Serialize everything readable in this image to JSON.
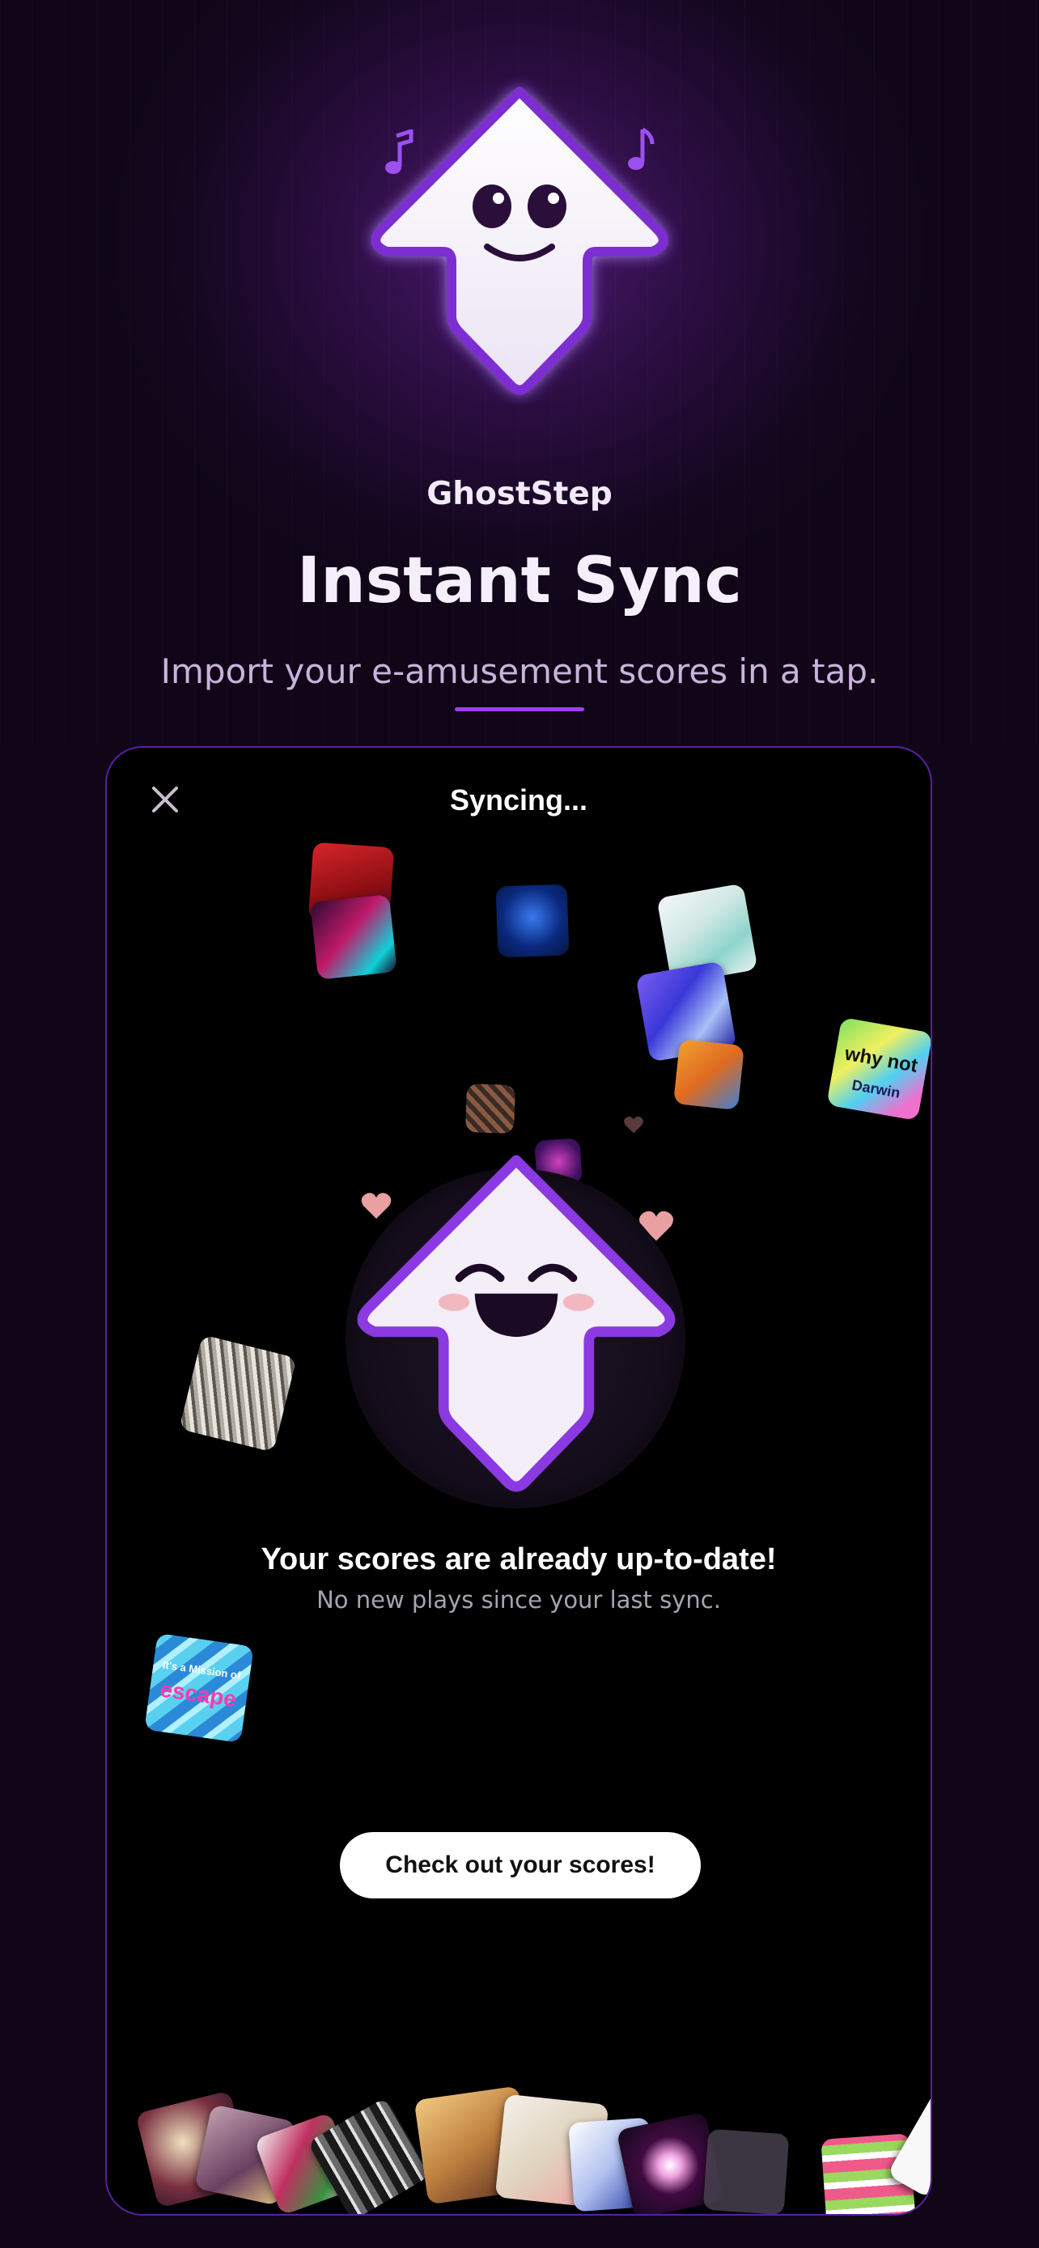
{
  "app_name": "GhostStep",
  "hero": {
    "headline": "Instant Sync",
    "subline": "Import your e-amusement scores in a tap."
  },
  "modal": {
    "title": "Syncing...",
    "result_title": "Your scores are already up-to-date!",
    "result_subtitle": "No new plays since your last sync.",
    "cta_label": "Check out your scores!"
  },
  "covers": {
    "why_not": {
      "line1": "why not",
      "line2": "Darwin"
    },
    "escape": {
      "line1": "It's a Mission of",
      "line2": "escape"
    }
  },
  "colors": {
    "background": "#100618",
    "accent": "#9d3ff0",
    "modal_border": "#5a20a0",
    "mascot_outline": "#7b2fd0",
    "heart": "#e8a0a0",
    "button_bg": "#ffffff"
  },
  "icons": [
    "close-icon",
    "music-note-icon",
    "heart-icon"
  ]
}
